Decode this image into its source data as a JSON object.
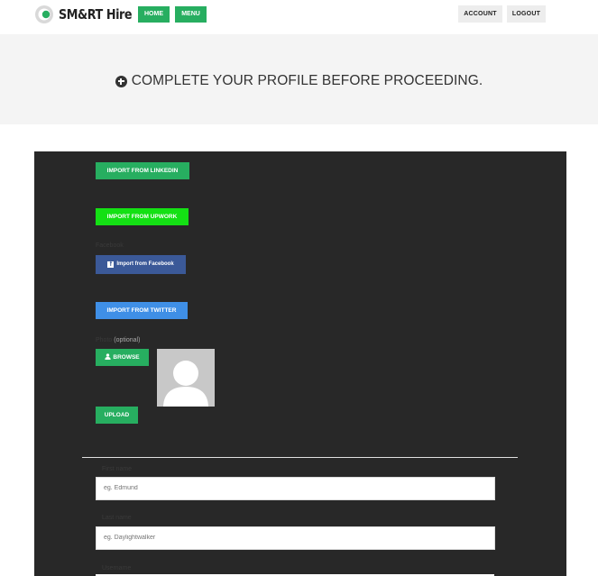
{
  "header": {
    "logo_text": "SM&RT Hire",
    "nav": {
      "home_label": "HOME",
      "menu_label": "MENU"
    },
    "account_label": "ACCOUNT",
    "logout_label": "LOGOUT"
  },
  "banner": {
    "message": "COMPLETE YOUR PROFILE BEFORE PROCEEDING."
  },
  "profile": {
    "linkedin_label": "IMPORT FROM LINKEDIN",
    "upwork_label": "IMPORT FROM UPWORK",
    "facebook_section_label": "Facebook",
    "facebook_label": "Import from Facebook",
    "twitter_label": "IMPORT FROM TWITTER",
    "photo_section_label": "Photo",
    "photo_optional": "(optional)",
    "browse_label": "BROWSE",
    "upload_label": "UPLOAD",
    "first_name_label": "First name",
    "first_name_placeholder": "eg. Edmund",
    "last_name_label": "Last name",
    "last_name_placeholder": "eg. Daylightwalker",
    "next_label": "Username"
  },
  "colors": {
    "green": "#27ae60",
    "upwork_green": "#14e014",
    "facebook_blue": "#3b5998",
    "twitter_blue": "#3f8fe6",
    "panel_bg": "#282828"
  }
}
